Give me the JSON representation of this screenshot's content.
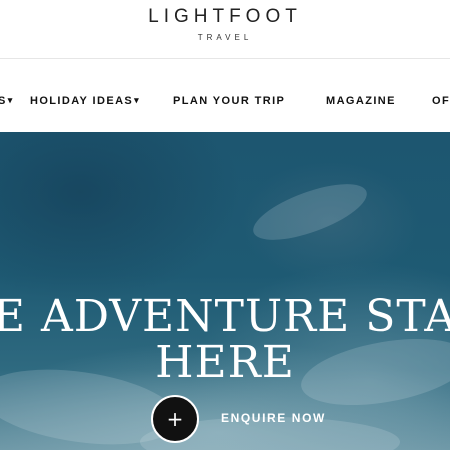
{
  "brand": {
    "name": "LIGHTFOOT",
    "tagline": "TRAVEL"
  },
  "nav": {
    "items": [
      {
        "label": "S",
        "caret": "▾"
      },
      {
        "label": "HOLIDAY IDEAS",
        "caret": "▾"
      },
      {
        "label": "PLAN YOUR TRIP"
      },
      {
        "label": "MAGAZINE"
      },
      {
        "label": "OF"
      }
    ]
  },
  "hero": {
    "title_line1": "E ADVENTURE STA",
    "title_line2": "HERE",
    "enquire_icon": "plus-icon",
    "enquire_symbol": "+",
    "enquire_label": "ENQUIRE NOW"
  },
  "colors": {
    "nav_text": "#111111",
    "hero_sea": "#1e5a73",
    "button_bg": "#111111",
    "hero_text": "#ffffff"
  }
}
